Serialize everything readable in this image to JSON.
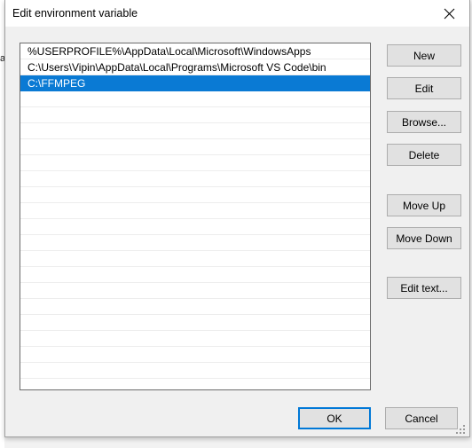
{
  "window": {
    "title": "Edit environment variable",
    "close_icon": "close-icon",
    "accent_color": "#0078d7",
    "selection_color": "#0a7ad4",
    "face_color": "#f0f0f0",
    "button_color": "#e1e1e1"
  },
  "backdrop": {
    "partial_text": "a"
  },
  "list": {
    "visible_row_count": 22,
    "selected_index": 2,
    "entries": [
      {
        "value": "%USERPROFILE%\\AppData\\Local\\Microsoft\\WindowsApps",
        "selected": false
      },
      {
        "value": "C:\\Users\\Vipin\\AppData\\Local\\Programs\\Microsoft VS Code\\bin",
        "selected": false
      },
      {
        "value": "C:\\FFMPEG",
        "selected": true
      }
    ]
  },
  "side_buttons": [
    {
      "id": "new",
      "label": "New"
    },
    {
      "id": "edit",
      "label": "Edit"
    },
    {
      "id": "browse",
      "label": "Browse..."
    },
    {
      "id": "delete",
      "label": "Delete"
    },
    {
      "id": "move-up",
      "label": "Move Up"
    },
    {
      "id": "move-down",
      "label": "Move Down"
    },
    {
      "id": "edit-text",
      "label": "Edit text..."
    }
  ],
  "bottom_buttons": {
    "ok_label": "OK",
    "cancel_label": "Cancel"
  },
  "resize_grip": "resize-grip-icon"
}
